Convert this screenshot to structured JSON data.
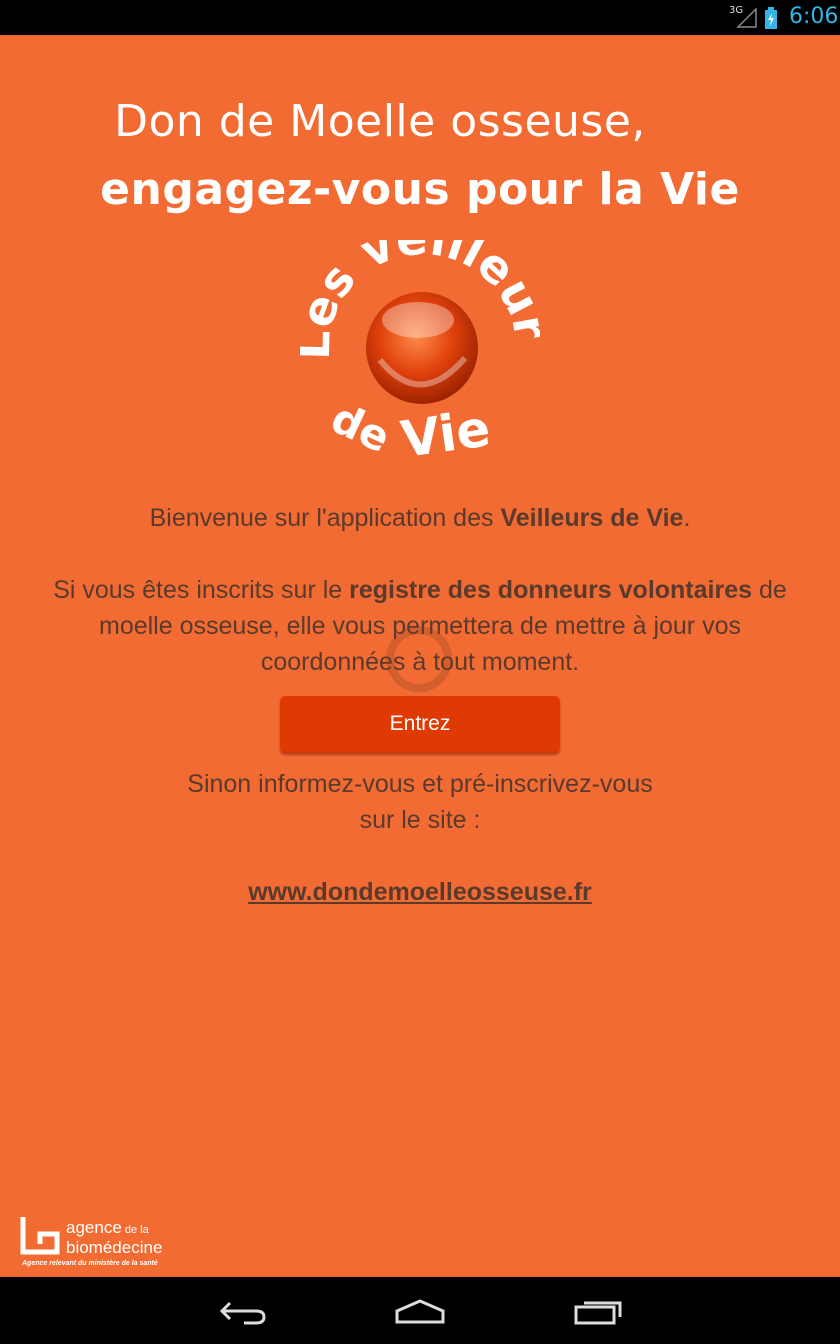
{
  "status_bar": {
    "network": "3G",
    "time": "6:06",
    "clock_color": "#33b5e5"
  },
  "headline": {
    "line1": "Don de Moelle osseuse,",
    "line2": "engagez-vous pour la Vie"
  },
  "logo": {
    "word_les": "Les",
    "word_veilleurs": "veilleurs",
    "word_de": "de",
    "word_vie": "Vie"
  },
  "welcome": {
    "prefix": "Bienvenue sur l'application des ",
    "app_name": "Veilleurs de Vie",
    "suffix": "."
  },
  "register": {
    "prefix": "Si vous êtes inscrits sur le ",
    "registry": "registre des donneurs volontaires",
    "mid": " de",
    "line2": "moelle osseuse, elle vous permettera de mettre à jour vos",
    "line3": "coordonnées à tout moment."
  },
  "enter_button": {
    "label": "Entrez"
  },
  "info": {
    "line1": "Sinon informez-vous et pré-inscrivez-vous",
    "line2": "sur le site :"
  },
  "website_link": "www.dondemoelleosseuse.fr",
  "agency": {
    "line1a": "agence",
    "line1b": " de la",
    "line2": "biomédecine",
    "tagline": "Agence relevant du ministère de la santé"
  },
  "colors": {
    "background": "#f26b32",
    "button": "#e03a04",
    "text": "#5a3a2c"
  },
  "nav": {
    "back": "back-icon",
    "home": "home-icon",
    "recents": "recent-apps-icon"
  }
}
